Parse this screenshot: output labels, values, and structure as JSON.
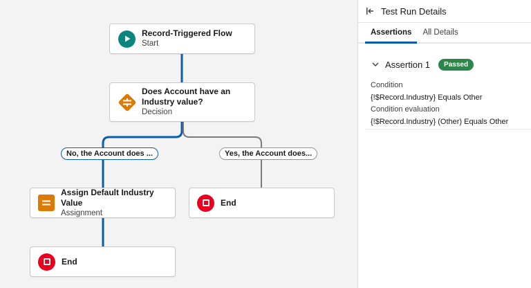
{
  "flow": {
    "start": {
      "title": "Record-Triggered Flow",
      "subtitle": "Start"
    },
    "decision": {
      "title": "Does Account have an Industry value?",
      "subtitle": "Decision"
    },
    "branch_left": "No, the Account does ...",
    "branch_right": "Yes, the Account does...",
    "assignment": {
      "title": "Assign Default Industry Value",
      "subtitle": "Assignment"
    },
    "end_right": {
      "title": "End"
    },
    "end_left": {
      "title": "End"
    }
  },
  "panel": {
    "title": "Test Run Details",
    "tabs": [
      {
        "label": "Assertions",
        "active": true
      },
      {
        "label": "All Details",
        "active": false
      }
    ],
    "assertion": {
      "name": "Assertion 1",
      "status": "Passed",
      "condition_label": "Condition",
      "condition_value": "{!$Record.Industry} Equals Other",
      "evaluation_label": "Condition evaluation",
      "evaluation_value": "{!$Record.Industry} (Other) Equals Other"
    }
  },
  "colors": {
    "path_active": "#0b5cab",
    "path_inactive": "#7a7a7a",
    "start_icon": "#0c8480",
    "decision_icon": "#dd7a01",
    "assignment_icon": "#dd7a01",
    "end_icon": "#ea001e",
    "passed_badge": "#2e844a"
  },
  "icons": {
    "start": "play-icon",
    "decision": "decision-icon",
    "assignment": "assignment-icon",
    "end": "stop-icon",
    "collapse": "collapse-panel-icon",
    "chevron": "chevron-down-icon"
  }
}
